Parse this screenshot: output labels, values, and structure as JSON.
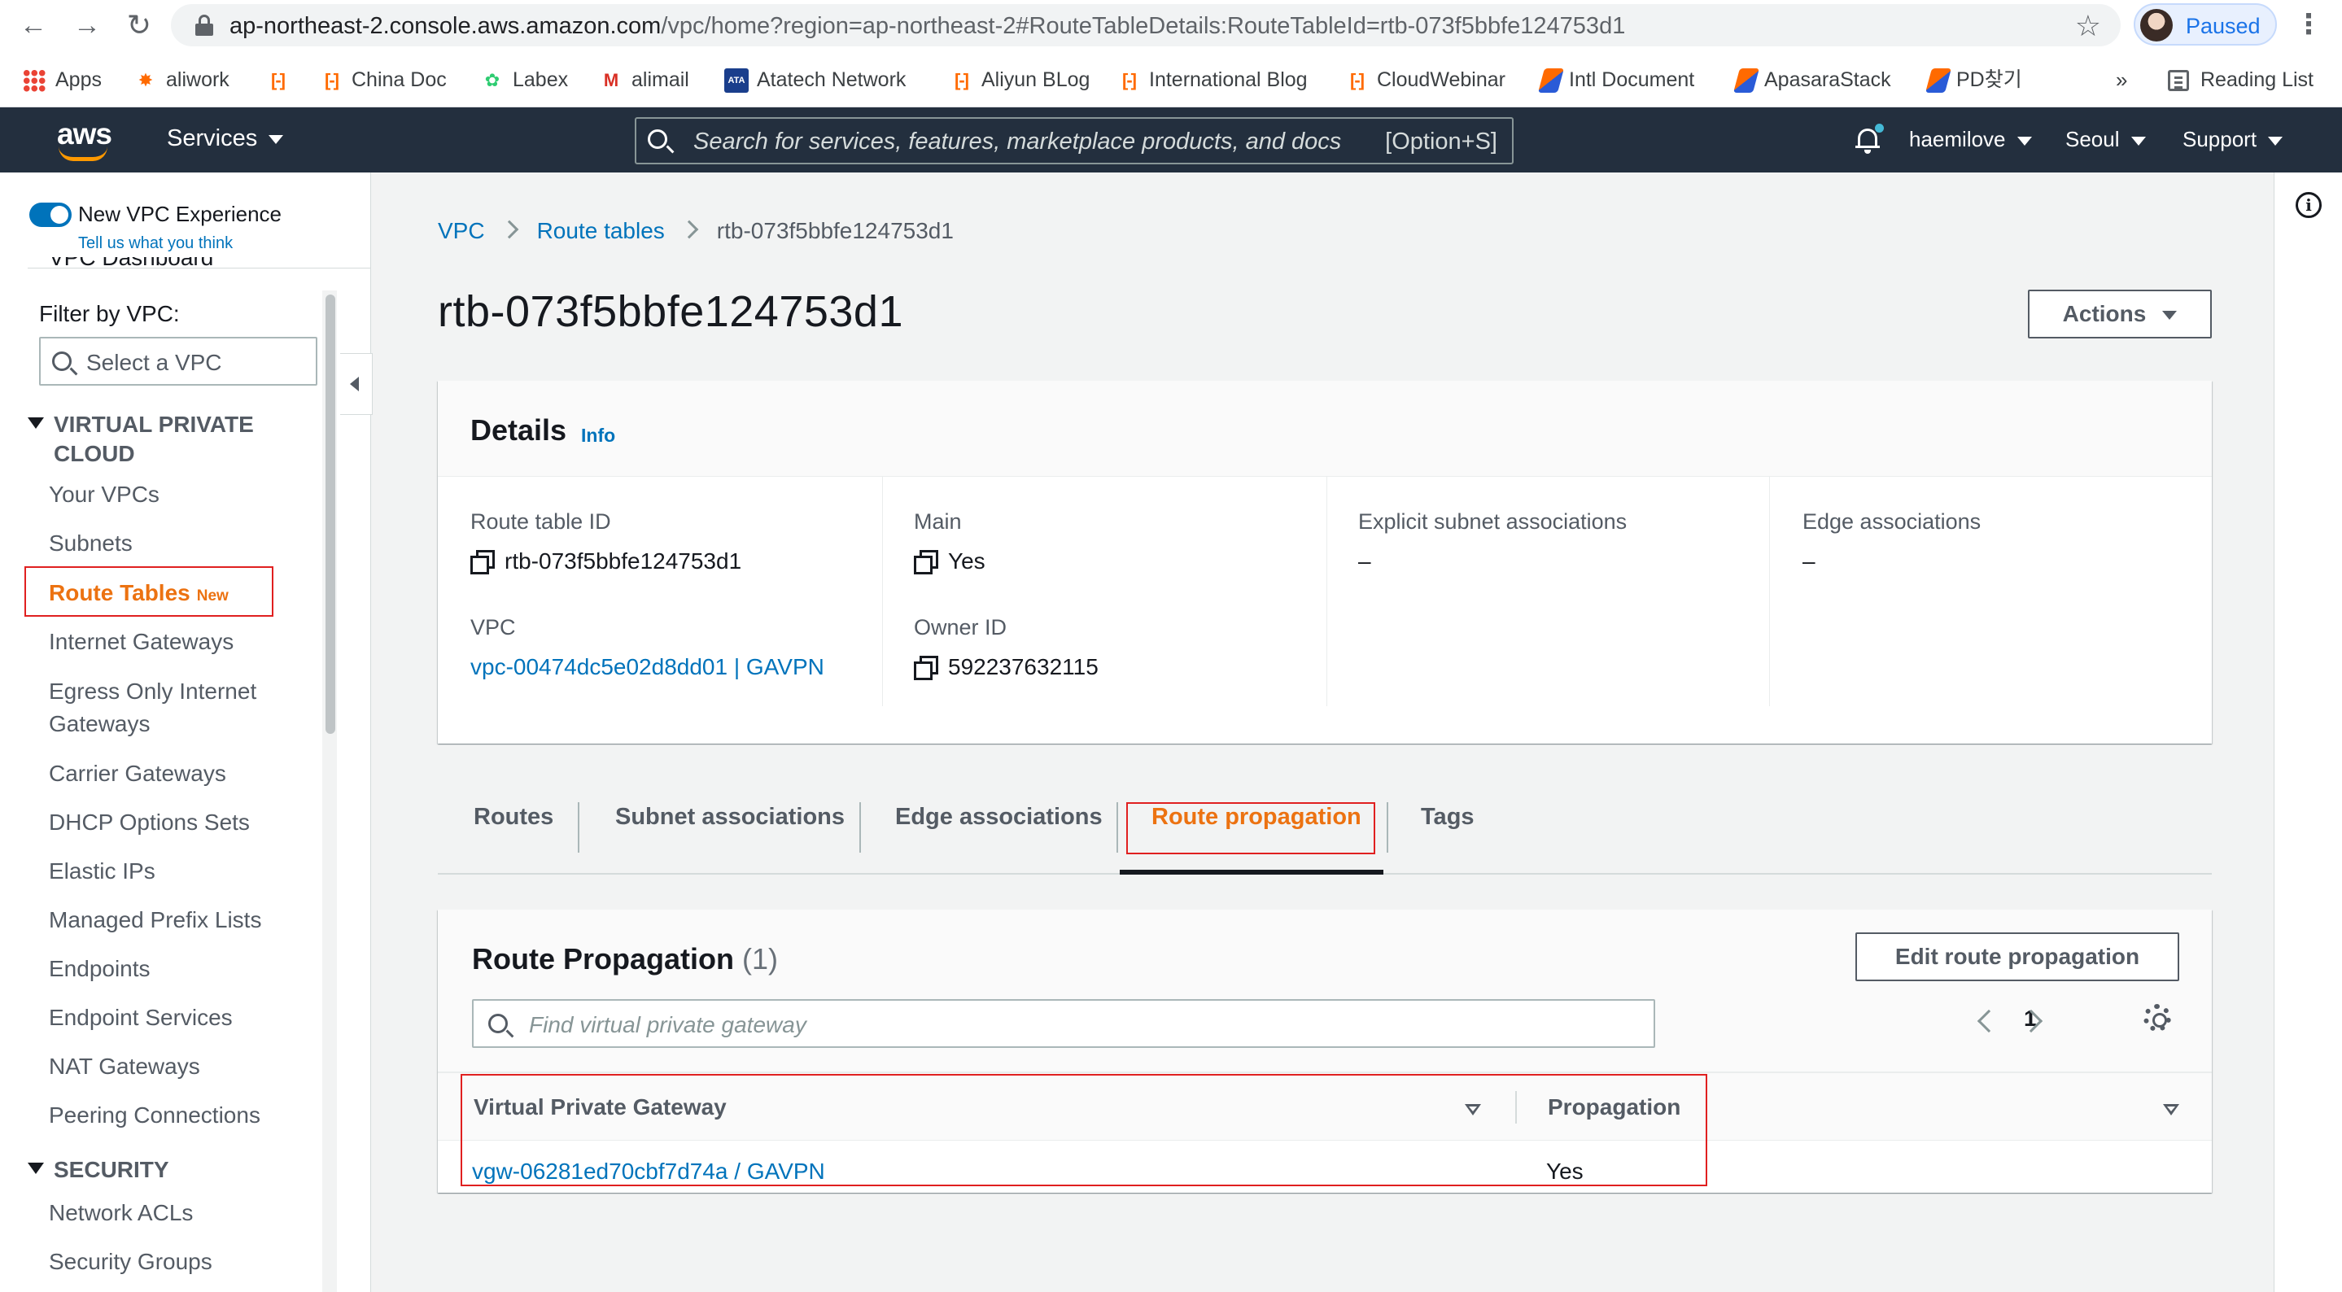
{
  "browser": {
    "url_host": "ap-northeast-2.console.aws.amazon.com",
    "url_path": "/vpc/home?region=ap-northeast-2#RouteTableDetails:RouteTableId=rtb-073f5bbfe124753d1",
    "profile_status": "Paused",
    "bookmarks": [
      "Apps",
      "aliwork",
      "China Doc",
      "Labex",
      "alimail",
      "Atatech Network",
      "Aliyun BLog",
      "International Blog",
      "CloudWebinar",
      "Intl Document",
      "ApasaraStack",
      "PD찾기"
    ],
    "overflow": "»",
    "reading_list": "Reading List"
  },
  "aws_nav": {
    "logo": "aws",
    "services": "Services",
    "search_placeholder": "Search for services, features, marketplace products, and docs",
    "search_shortcut": "[Option+S]",
    "user": "haemilove",
    "region": "Seoul",
    "support": "Support"
  },
  "sidebar": {
    "experience_title": "New VPC Experience",
    "experience_link": "Tell us what you think",
    "cut_item": "VPC Dashboard",
    "filter_label": "Filter by VPC:",
    "filter_placeholder": "Select a VPC",
    "sections": [
      {
        "title_lines": [
          "VIRTUAL PRIVATE",
          "CLOUD"
        ],
        "items": [
          "Your VPCs",
          "Subnets",
          "Route Tables",
          "Internet Gateways",
          "Egress Only Internet",
          "Gateways",
          "Carrier Gateways",
          "DHCP Options Sets",
          "Elastic IPs",
          "Managed Prefix Lists",
          "Endpoints",
          "Endpoint Services",
          "NAT Gateways",
          "Peering Connections"
        ]
      },
      {
        "title_lines": [
          "SECURITY"
        ],
        "items": [
          "Network ACLs",
          "Security Groups"
        ]
      }
    ],
    "active_badge": "New"
  },
  "breadcrumb": [
    "VPC",
    "Route tables",
    "rtb-073f5bbfe124753d1"
  ],
  "page_title": "rtb-073f5bbfe124753d1",
  "actions_label": "Actions",
  "details": {
    "title": "Details",
    "info": "Info",
    "route_table_id_label": "Route table ID",
    "route_table_id": "rtb-073f5bbfe124753d1",
    "vpc_label": "VPC",
    "vpc": "vpc-00474dc5e02d8dd01 | GAVPN",
    "main_label": "Main",
    "main": "Yes",
    "owner_label": "Owner ID",
    "owner": "592237632115",
    "explicit_label": "Explicit subnet associations",
    "explicit": "–",
    "edge_label": "Edge associations",
    "edge": "–"
  },
  "tabs": [
    "Routes",
    "Subnet associations",
    "Edge associations",
    "Route propagation",
    "Tags"
  ],
  "route_propagation": {
    "title": "Route Propagation",
    "count": "(1)",
    "edit_button": "Edit route propagation",
    "filter_placeholder": "Find virtual private gateway",
    "page": "1",
    "columns": [
      "Virtual Private Gateway",
      "Propagation"
    ],
    "rows": [
      {
        "gateway": "vgw-06281ed70cbf7d74a / GAVPN",
        "propagation": "Yes"
      }
    ]
  },
  "colors": {
    "aws_nav_bg": "#232f3e",
    "accent_orange": "#ec7211",
    "link_blue": "#0073bb",
    "highlight_red": "#e02020"
  }
}
